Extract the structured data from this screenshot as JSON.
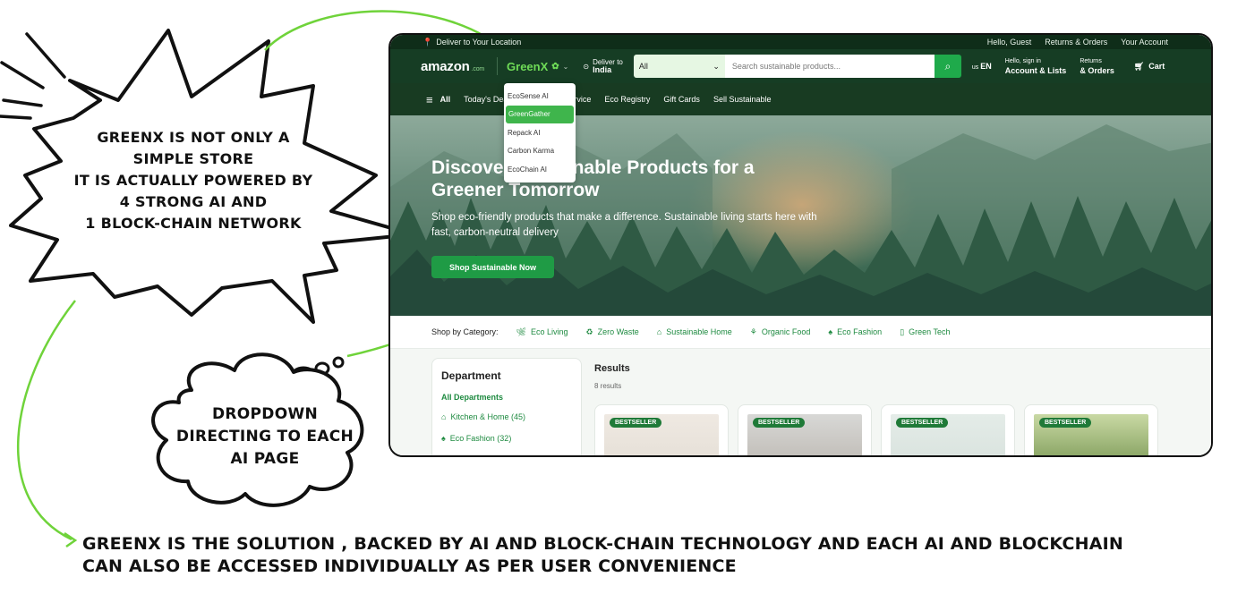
{
  "annotations": {
    "burst": [
      "GREENX is not only a simple store",
      "it is actually powered by 4 strong ai and",
      "1 block-chain network"
    ],
    "cloud": [
      "Dropdown directing to each",
      "AI page"
    ],
    "bottom": "GREENX IS THE SOLUTION , BACKED BY AI AND BLOCK-CHAIN TECHNOLOGY AND EACH AI AND BLOCKCHAIN CAN ALSO BE ACCESSED INDIVIDUALLY AS PER USER CONVENIENCE",
    "arrow_color": "#6fd33a"
  },
  "topstrip": {
    "deliver": "Deliver to Your Location",
    "links": [
      "Hello, Guest",
      "Returns & Orders",
      "Your Account"
    ]
  },
  "navbar": {
    "logo": "amazon",
    "logo_suffix": ".com",
    "brand": "GreenX",
    "deliver_line1": "Deliver to",
    "deliver_line2": "India",
    "search_category": "All",
    "search_placeholder": "Search sustainable products...",
    "lang_prefix": "us",
    "lang": "EN",
    "account_line1": "Hello, sign in",
    "account_line2": "Account & Lists",
    "returns_line1": "Returns",
    "returns_line2": "& Orders",
    "cart": "Cart"
  },
  "subnav": {
    "all": "All",
    "items": [
      "Today's Deals",
      "Customer Service",
      "Eco Registry",
      "Gift Cards",
      "Sell Sustainable"
    ]
  },
  "dropdown": {
    "items": [
      "EcoSense AI",
      "GreenGather",
      "Repack AI",
      "Carbon Karma",
      "EcoChain AI"
    ],
    "active_index": 1
  },
  "hero": {
    "title": "Discover Sustainable Products for a Greener Tomorrow",
    "subtitle": "Shop eco-friendly products that make a difference. Sustainable living starts here with fast, carbon-neutral delivery",
    "cta": "Shop Sustainable Now"
  },
  "categories": {
    "label": "Shop by Category:",
    "items": [
      {
        "label": "Eco Living",
        "icon": "leaf-icon"
      },
      {
        "label": "Zero Waste",
        "icon": "recycle-icon"
      },
      {
        "label": "Sustainable Home",
        "icon": "home-icon"
      },
      {
        "label": "Organic Food",
        "icon": "sprout-icon"
      },
      {
        "label": "Eco Fashion",
        "icon": "shirt-icon"
      },
      {
        "label": "Green Tech",
        "icon": "battery-icon"
      }
    ]
  },
  "department": {
    "title": "Department",
    "all": "All Departments",
    "items": [
      "Kitchen & Home (45)",
      "Eco Fashion (32)"
    ]
  },
  "results": {
    "title": "Results",
    "count": "8 results",
    "badge": "BESTSELLER"
  },
  "colors": {
    "dark_green": "#0f2d19",
    "accent_green": "#1faa4b",
    "brand_green": "#6fdc57"
  }
}
